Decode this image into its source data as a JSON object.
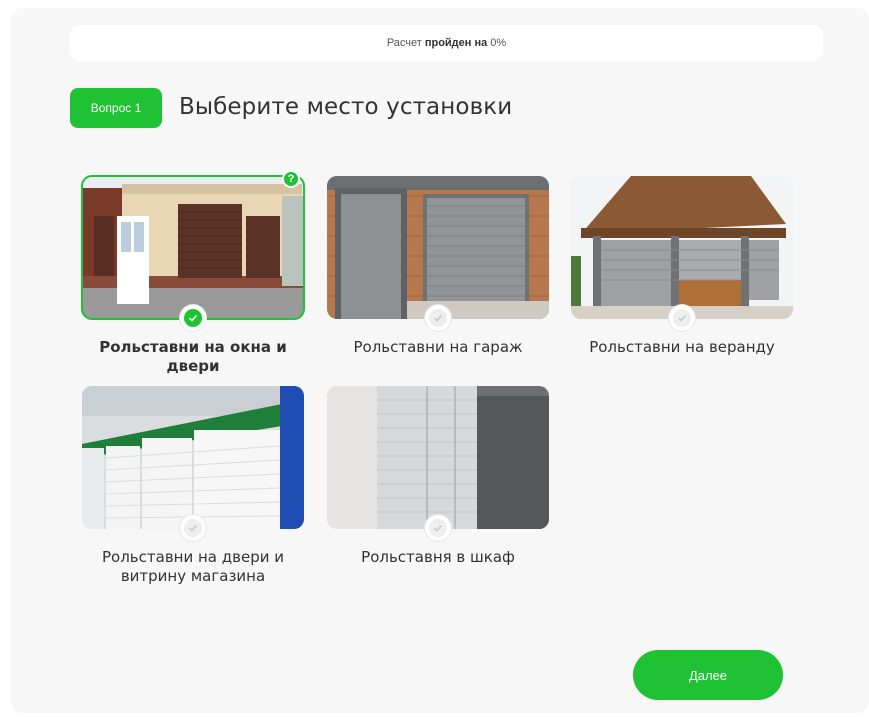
{
  "progress": {
    "prefix": "Расчет",
    "bold": "пройден на",
    "value": "0%"
  },
  "question": {
    "badge": "Вопрос 1",
    "title": "Выберите место установки"
  },
  "options": [
    {
      "label": "Рольставни на окна и двери",
      "selected": true,
      "help": "?"
    },
    {
      "label": "Рольставни на гараж",
      "selected": false
    },
    {
      "label": "Рольставни на веранду",
      "selected": false
    },
    {
      "label": "Рольставни на двери и витрину магазина",
      "selected": false
    },
    {
      "label": "Рольставня в шкаф",
      "selected": false
    }
  ],
  "next_button": "Далее",
  "colors": {
    "accent": "#1ec232",
    "panel": "#f7f7f7"
  }
}
